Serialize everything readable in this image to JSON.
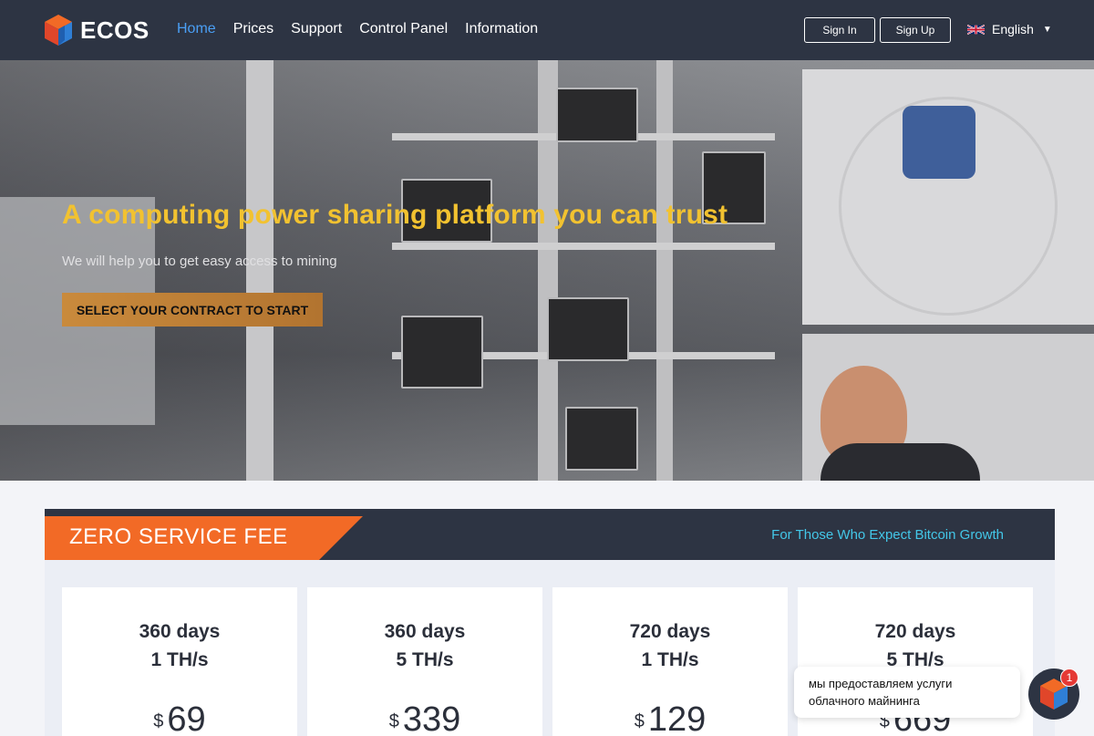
{
  "header": {
    "logo_text": "ECOS",
    "nav": [
      {
        "label": "Home",
        "active": true
      },
      {
        "label": "Prices",
        "active": false
      },
      {
        "label": "Support",
        "active": false
      },
      {
        "label": "Control Panel",
        "active": false
      },
      {
        "label": "Information",
        "active": false
      }
    ],
    "sign_in": "Sign In",
    "sign_up": "Sign Up",
    "language": "English",
    "language_icon": "uk-flag-icon"
  },
  "hero": {
    "title": "A computing power sharing platform you can trust",
    "subtitle": "We will help you to get easy access to mining",
    "cta": "SELECT YOUR CONTRACT TO START"
  },
  "plans": {
    "badge": "ZERO SERVICE FEE",
    "tagline": "For Those Who Expect Bitcoin Growth",
    "cards": [
      {
        "days": "360 days",
        "ths": "1 TH/s",
        "currency": "$",
        "price": "69"
      },
      {
        "days": "360 days",
        "ths": "5 TH/s",
        "currency": "$",
        "price": "339"
      },
      {
        "days": "720 days",
        "ths": "1 TH/s",
        "currency": "$",
        "price": "129"
      },
      {
        "days": "720 days",
        "ths": "5 TH/s",
        "currency": "$",
        "price": "669"
      }
    ]
  },
  "chat": {
    "message": "мы предоставляем услуги облачного майнинга",
    "unread": "1"
  },
  "colors": {
    "header_bg": "#2d3443",
    "accent_blue": "#4a9ff5",
    "hero_title": "#f2c230",
    "fee_orange": "#f26a26",
    "tagline_cyan": "#43c7e8"
  }
}
